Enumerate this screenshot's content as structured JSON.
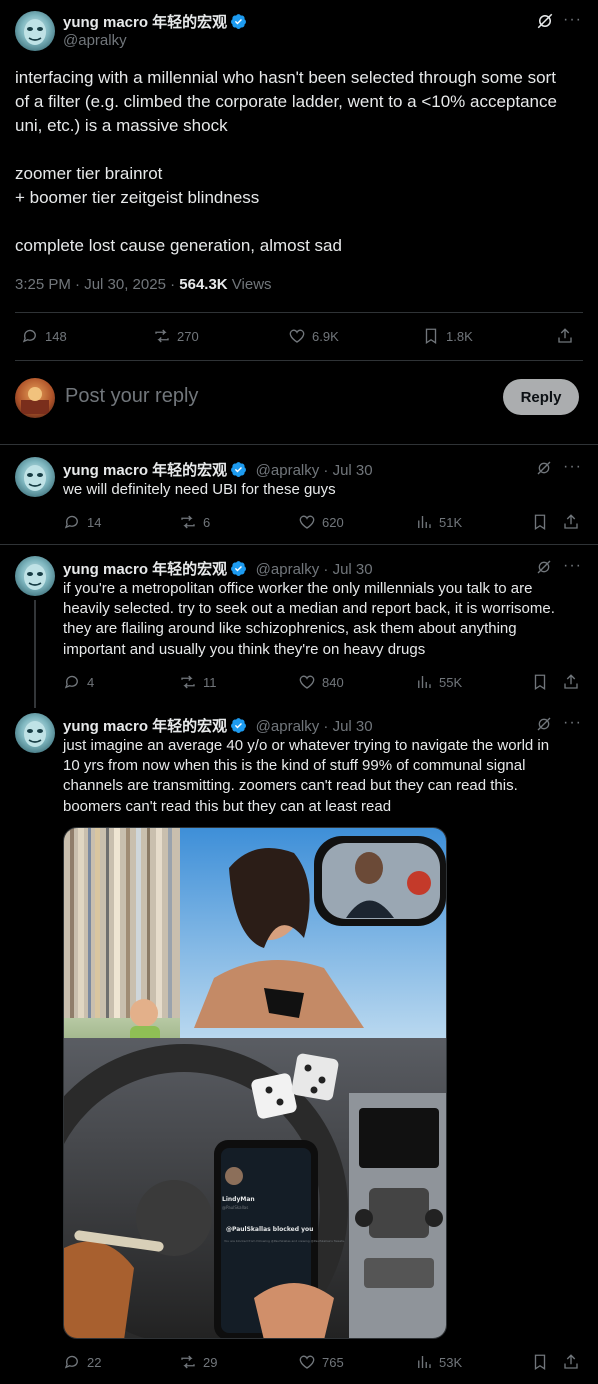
{
  "main_tweet": {
    "name": "yung macro 年轻的宏观",
    "handle": "@apralky",
    "lines": [
      "interfacing with a millennial who hasn't been selected through some sort",
      "of a filter (e.g. climbed the corporate ladder, went to a <10% acceptance",
      "uni, etc.) is a massive shock",
      "",
      "zoomer tier brainrot",
      "+ boomer tier zeitgeist blindness",
      "",
      "complete lost cause generation, almost sad"
    ],
    "time": "3:25 PM · Jul 30, 2025 · ",
    "views_count": "564.3K",
    "views_label": " Views",
    "replies": "148",
    "reposts": "270",
    "likes": "6.9K",
    "bookmarks": "1.8K"
  },
  "reply_box": {
    "placeholder": "Post your reply",
    "button": "Reply"
  },
  "replies": [
    {
      "name": "yung macro 年轻的宏观",
      "meta": "@apralky · Jul 30",
      "lines": [
        "we will definitely need UBI for these guys"
      ],
      "replies": "14",
      "reposts": "6",
      "likes": "620",
      "views": "51K"
    },
    {
      "name": "yung macro 年轻的宏观",
      "meta": "@apralky · Jul 30",
      "lines": [
        "if you're a metropolitan office worker the only millennials you talk to are",
        "heavily selected. try to seek out a median and report back, it is worrisome.",
        "they are flailing around like schizophrenics, ask them about anything",
        "important and usually you think they're on heavy drugs"
      ],
      "replies": "4",
      "reposts": "11",
      "likes": "840",
      "views": "55K"
    },
    {
      "name": "yung macro 年轻的宏观",
      "meta": "@apralky · Jul 30",
      "lines": [
        "just imagine an average 40 y/o or whatever trying to navigate the world in",
        "10 yrs from now when this is the kind of stuff 99% of communal signal",
        "channels are transmitting. zoomers can't read but they can read this.",
        "boomers can't read this but they can at least read"
      ],
      "replies": "22",
      "reposts": "29",
      "likes": "765",
      "views": "53K"
    }
  ],
  "image": {
    "phone_name": "LindyMan",
    "phone_handle": "@PaulSkallas",
    "phone_msg": "@PaulSkallas blocked you",
    "phone_sub": "You are blocked from following @PaulSkallas and viewing @PaulSkallas's Tweets."
  }
}
